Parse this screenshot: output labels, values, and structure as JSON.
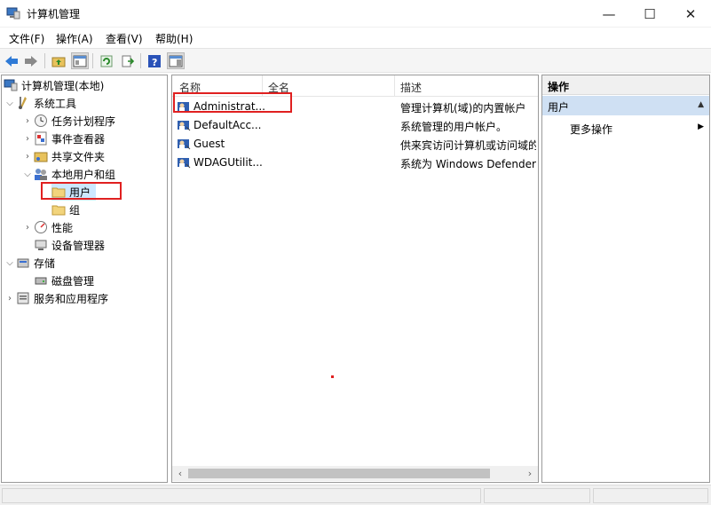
{
  "window": {
    "title": "计算机管理",
    "controls": {
      "minimize": "—",
      "maximize": "☐",
      "close": "✕"
    }
  },
  "menu": [
    "文件(F)",
    "操作(A)",
    "查看(V)",
    "帮助(H)"
  ],
  "tree": {
    "root": "计算机管理(本地)",
    "system_tools": "系统工具",
    "task_scheduler": "任务计划程序",
    "event_viewer": "事件查看器",
    "shared_folders": "共享文件夹",
    "local_users_groups": "本地用户和组",
    "users": "用户",
    "groups": "组",
    "performance": "性能",
    "device_manager": "设备管理器",
    "storage": "存储",
    "disk_management": "磁盘管理",
    "services_apps": "服务和应用程序"
  },
  "list": {
    "columns": [
      "名称",
      "全名",
      "描述"
    ],
    "rows": [
      {
        "name": "Administrat...",
        "fullname": "",
        "description": "管理计算机(域)的内置帐户"
      },
      {
        "name": "DefaultAcc...",
        "fullname": "",
        "description": "系统管理的用户帐户。"
      },
      {
        "name": "Guest",
        "fullname": "",
        "description": "供来宾访问计算机或访问域的"
      },
      {
        "name": "WDAGUtilit...",
        "fullname": "",
        "description": "系统为 Windows Defender"
      }
    ]
  },
  "actions": {
    "header": "操作",
    "section": "用户",
    "more": "更多操作"
  },
  "colors": {
    "highlight": "#e02020",
    "selected_bg": "#cce8ff",
    "actions_section_bg": "#cfe0f3"
  }
}
